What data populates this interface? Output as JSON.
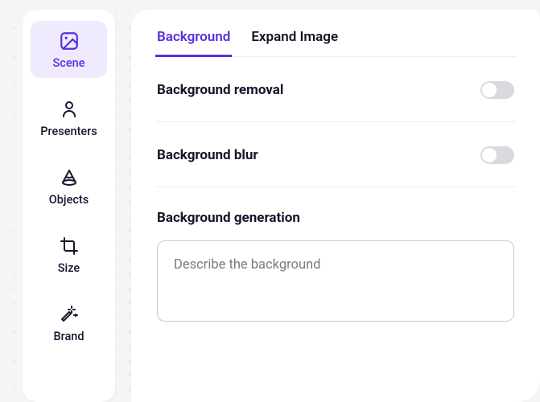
{
  "sidebar": {
    "items": [
      {
        "label": "Scene"
      },
      {
        "label": "Presenters"
      },
      {
        "label": "Objects"
      },
      {
        "label": "Size"
      },
      {
        "label": "Brand"
      }
    ]
  },
  "tabs": {
    "background": "Background",
    "expand": "Expand Image"
  },
  "sections": {
    "removal_title": "Background removal",
    "blur_title": "Background blur",
    "generation_title": "Background generation",
    "generation_placeholder": "Describe the background"
  }
}
